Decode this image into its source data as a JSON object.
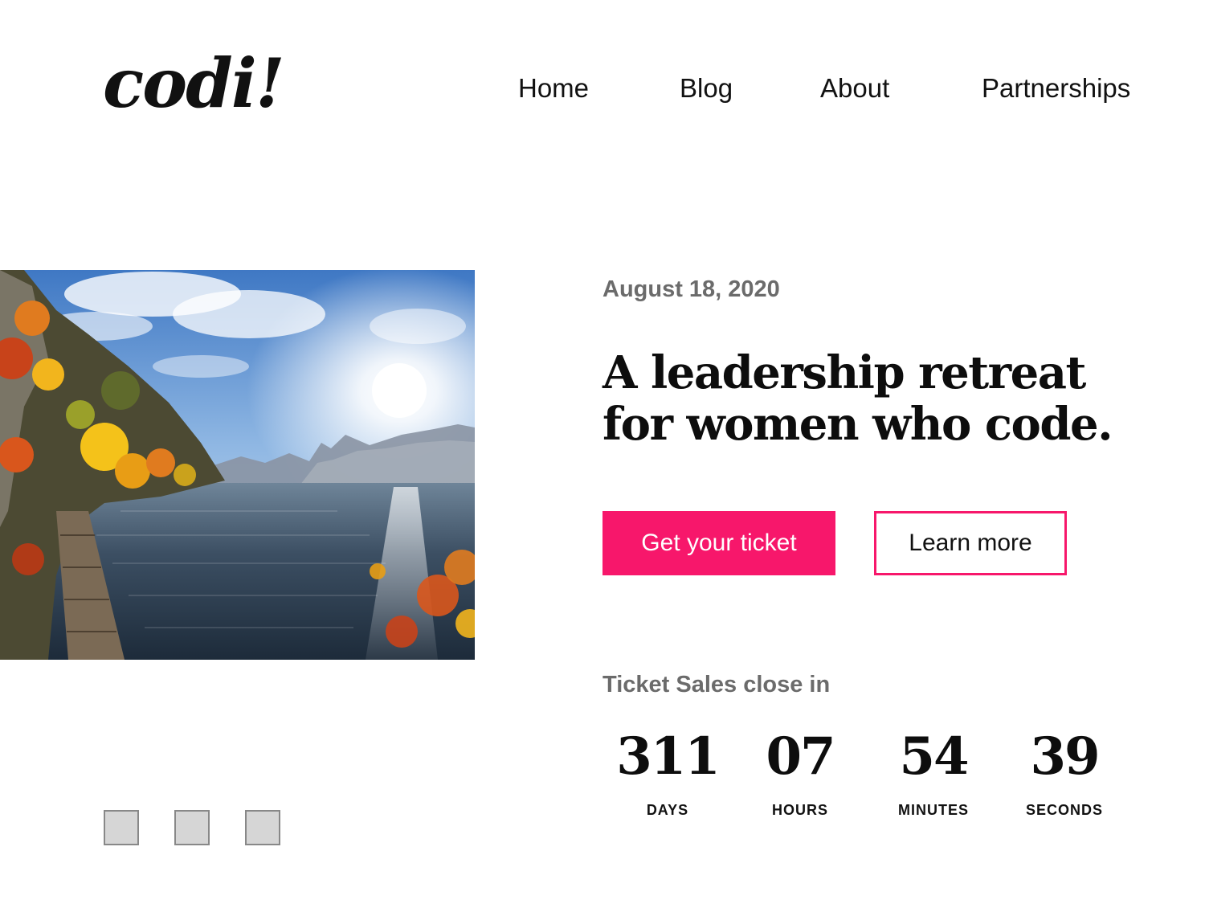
{
  "header": {
    "logo": "codi!",
    "nav": [
      {
        "label": "Home"
      },
      {
        "label": "Blog"
      },
      {
        "label": "About"
      },
      {
        "label": "Partnerships"
      }
    ]
  },
  "hero": {
    "image_alt": "Autumn lake landscape with mountains and sunlight",
    "date": "August 18, 2020",
    "headline": "A leadership retreat for women who code.",
    "primary_button": "Get your ticket",
    "secondary_button": "Learn more"
  },
  "countdown": {
    "label": "Ticket Sales close in",
    "units": [
      {
        "value": "311",
        "name": "DAYS"
      },
      {
        "value": "07",
        "name": "HOURS"
      },
      {
        "value": "54",
        "name": "MINUTES"
      },
      {
        "value": "39",
        "name": "SECONDS"
      }
    ]
  },
  "carousel": {
    "slide_count": 3
  },
  "colors": {
    "accent": "#f7176b",
    "muted_text": "#6b6b6b",
    "text": "#111111",
    "background": "#ffffff"
  }
}
